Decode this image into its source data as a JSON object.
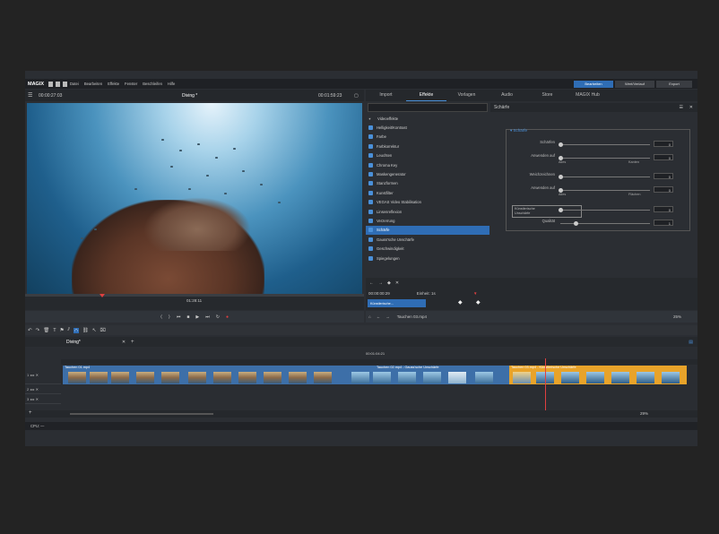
{
  "window": {
    "close_label": "X"
  },
  "menubar": {
    "logo": "MAGIX",
    "items": [
      "Datei",
      "Bearbeiten",
      "Effekte",
      "Fenster",
      "Beschleifen",
      "Hilfe"
    ],
    "buttons": [
      "Bearbeiten",
      "Wert/Verlauf",
      "Export"
    ]
  },
  "preview": {
    "time_current": "00:00:27:03",
    "title": "Diving *",
    "time_total": "00:01:59:23",
    "scrub_time": "01:28:11"
  },
  "tabs": [
    "Import",
    "Effekte",
    "Vorlagen",
    "Audio",
    "Store",
    "MAGIX Hub"
  ],
  "active_tab": "Effekte",
  "effects": {
    "category": "Videoeffekte",
    "items": [
      "Helligkeit/Kontrast",
      "Farbe",
      "Farbkorrektur",
      "Leuchten",
      "Chroma Key",
      "Maskengenerator",
      "Stanzformen",
      "Kunstfilter",
      "VEGAS Video Stabilisation",
      "Linsenreflexion",
      "Verzerrung",
      "Schärfe",
      "Gauss'sche Unschärfe",
      "Geschwindigkeit",
      "Spiegelungen"
    ],
    "selected": "Schärfe"
  },
  "detail": {
    "title": "Schärfe",
    "group": "Schärfe",
    "rows": [
      {
        "label": "Schärfen",
        "value": "0"
      },
      {
        "label": "Anwenden auf",
        "value": "0",
        "left": "Alles",
        "right": "Kanten"
      },
      {
        "label": "Weichzeichnen",
        "value": "0"
      },
      {
        "label": "Anwenden auf",
        "value": "0",
        "left": "Alles",
        "right": "Flächen"
      },
      {
        "label": "Künstlerische Unschärfe",
        "value": "0"
      },
      {
        "label": "Qualität",
        "value": "1"
      }
    ]
  },
  "keyframe": {
    "time": "00:00:00:29",
    "unit": "Einheit: 1s",
    "track_label": "Künstlerische..."
  },
  "browser": {
    "path": "Tauchen 03.mp4",
    "zoom": "25%"
  },
  "project": {
    "tab": "Diving*",
    "ruler_time": "00:01:04:21"
  },
  "timeline": {
    "clips": [
      {
        "name": "Tauchen 01.mp4"
      },
      {
        "name": "Tauchen 02.mp4 - Gauss'sche Unschärfe"
      },
      {
        "name": "Tauchen 03.mp4 - Künstlerische Unschärfe"
      }
    ],
    "zoom": "29%"
  },
  "status": {
    "text": "CPU: —"
  },
  "colors": {
    "accent": "#4a90d9",
    "selected_clip": "#e8a32a",
    "playhead": "#e04040"
  }
}
